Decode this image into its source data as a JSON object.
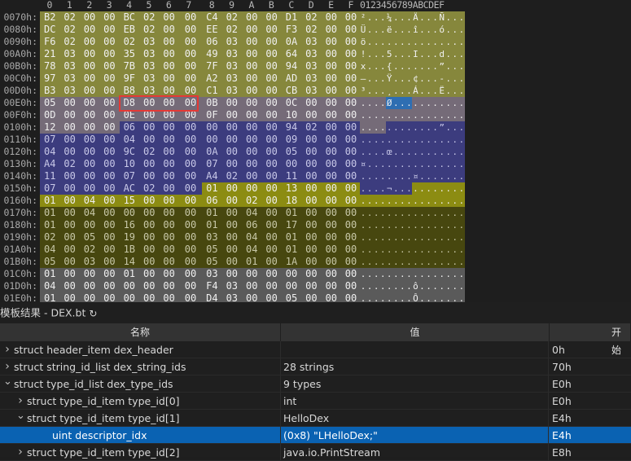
{
  "hex_editor": {
    "columns": [
      "0",
      "1",
      "2",
      "3",
      "4",
      "5",
      "6",
      "7",
      "8",
      "9",
      "A",
      "B",
      "C",
      "D",
      "E",
      "F"
    ],
    "ascii_header": "0123456789ABCDEF",
    "rows": [
      {
        "offset": "0070h:",
        "bytes": [
          "B2",
          "02",
          "00",
          "00",
          "BC",
          "02",
          "00",
          "00",
          "C4",
          "02",
          "00",
          "00",
          "D1",
          "02",
          "00",
          "00"
        ],
        "ascii": "²...¼...Ä...Ñ...",
        "region": "olive-a"
      },
      {
        "offset": "0080h:",
        "bytes": [
          "DC",
          "02",
          "00",
          "00",
          "EB",
          "02",
          "00",
          "00",
          "EE",
          "02",
          "00",
          "00",
          "F3",
          "02",
          "00",
          "00"
        ],
        "ascii": "Ü...ë...î...ó...",
        "region": "olive-a"
      },
      {
        "offset": "0090h:",
        "bytes": [
          "F6",
          "02",
          "00",
          "00",
          "02",
          "03",
          "00",
          "00",
          "06",
          "03",
          "00",
          "00",
          "0A",
          "03",
          "00",
          "00"
        ],
        "ascii": "ö...............",
        "region": "olive-a"
      },
      {
        "offset": "00A0h:",
        "bytes": [
          "21",
          "03",
          "00",
          "00",
          "35",
          "03",
          "00",
          "00",
          "49",
          "03",
          "00",
          "00",
          "64",
          "03",
          "00",
          "00"
        ],
        "ascii": "!...5...I...d...",
        "region": "olive-a"
      },
      {
        "offset": "00B0h:",
        "bytes": [
          "78",
          "03",
          "00",
          "00",
          "7B",
          "03",
          "00",
          "00",
          "7F",
          "03",
          "00",
          "00",
          "94",
          "03",
          "00",
          "00"
        ],
        "ascii": "x...{.......”...",
        "region": "olive-a"
      },
      {
        "offset": "00C0h:",
        "bytes": [
          "97",
          "03",
          "00",
          "00",
          "9F",
          "03",
          "00",
          "00",
          "A2",
          "03",
          "00",
          "00",
          "AD",
          "03",
          "00",
          "00"
        ],
        "ascii": "–...Ÿ...¢...-...",
        "region": "olive-a"
      },
      {
        "offset": "00D0h:",
        "bytes": [
          "B3",
          "03",
          "00",
          "00",
          "B8",
          "03",
          "00",
          "00",
          "C1",
          "03",
          "00",
          "00",
          "CB",
          "03",
          "00",
          "00"
        ],
        "ascii": "³...¸...Á...Ë...",
        "region": "olive-a"
      },
      {
        "offset": "00E0h:",
        "bytes": [
          "05",
          "00",
          "00",
          "00",
          "D8",
          "00",
          "00",
          "00",
          "0B",
          "00",
          "00",
          "00",
          "0C",
          "00",
          "00",
          "00"
        ],
        "ascii": "....Ø...........",
        "region": "mauve"
      },
      {
        "offset": "00F0h:",
        "bytes": [
          "0D",
          "00",
          "00",
          "00",
          "0E",
          "00",
          "00",
          "00",
          "0F",
          "00",
          "00",
          "00",
          "10",
          "00",
          "00",
          "00"
        ],
        "ascii": "................",
        "region": "mauve"
      },
      {
        "offset": "0100h:",
        "bytes": [
          "12",
          "00",
          "00",
          "00",
          "06",
          "00",
          "00",
          "00",
          "00",
          "00",
          "00",
          "00",
          "94",
          "02",
          "00",
          "00"
        ],
        "ascii": "............”...",
        "region": "mix-100"
      },
      {
        "offset": "0110h:",
        "bytes": [
          "07",
          "00",
          "00",
          "00",
          "04",
          "00",
          "00",
          "00",
          "00",
          "00",
          "00",
          "00",
          "09",
          "00",
          "00",
          "00"
        ],
        "ascii": "................",
        "region": "blue"
      },
      {
        "offset": "0120h:",
        "bytes": [
          "04",
          "00",
          "00",
          "00",
          "9C",
          "02",
          "00",
          "00",
          "0A",
          "00",
          "00",
          "00",
          "05",
          "00",
          "00",
          "00"
        ],
        "ascii": "....œ...........",
        "region": "blue"
      },
      {
        "offset": "0130h:",
        "bytes": [
          "A4",
          "02",
          "00",
          "00",
          "10",
          "00",
          "00",
          "00",
          "07",
          "00",
          "00",
          "00",
          "00",
          "00",
          "00",
          "00"
        ],
        "ascii": "¤...............",
        "region": "blue"
      },
      {
        "offset": "0140h:",
        "bytes": [
          "11",
          "00",
          "00",
          "00",
          "07",
          "00",
          "00",
          "00",
          "A4",
          "02",
          "00",
          "00",
          "11",
          "00",
          "00",
          "00"
        ],
        "ascii": "........¤.......",
        "region": "blue"
      },
      {
        "offset": "0150h:",
        "bytes": [
          "07",
          "00",
          "00",
          "00",
          "AC",
          "02",
          "00",
          "00",
          "01",
          "00",
          "00",
          "00",
          "13",
          "00",
          "00",
          "00"
        ],
        "ascii": "....¬...........",
        "region": "mix-150"
      },
      {
        "offset": "0160h:",
        "bytes": [
          "01",
          "00",
          "04",
          "00",
          "15",
          "00",
          "00",
          "00",
          "06",
          "00",
          "02",
          "00",
          "18",
          "00",
          "00",
          "00"
        ],
        "ascii": "................",
        "region": "olive-b"
      },
      {
        "offset": "0170h:",
        "bytes": [
          "01",
          "00",
          "04",
          "00",
          "00",
          "00",
          "00",
          "00",
          "01",
          "00",
          "04",
          "00",
          "01",
          "00",
          "00",
          "00"
        ],
        "ascii": "................",
        "region": "olive-c"
      },
      {
        "offset": "0180h:",
        "bytes": [
          "01",
          "00",
          "00",
          "00",
          "16",
          "00",
          "00",
          "00",
          "01",
          "00",
          "06",
          "00",
          "17",
          "00",
          "00",
          "00"
        ],
        "ascii": "................",
        "region": "olive-c"
      },
      {
        "offset": "0190h:",
        "bytes": [
          "02",
          "00",
          "05",
          "00",
          "19",
          "00",
          "00",
          "00",
          "03",
          "00",
          "04",
          "00",
          "01",
          "00",
          "00",
          "00"
        ],
        "ascii": "................",
        "region": "olive-c"
      },
      {
        "offset": "01A0h:",
        "bytes": [
          "04",
          "00",
          "02",
          "00",
          "1B",
          "00",
          "00",
          "00",
          "05",
          "00",
          "04",
          "00",
          "01",
          "00",
          "00",
          "00"
        ],
        "ascii": "................",
        "region": "olive-c"
      },
      {
        "offset": "01B0h:",
        "bytes": [
          "05",
          "00",
          "03",
          "00",
          "14",
          "00",
          "00",
          "00",
          "05",
          "00",
          "01",
          "00",
          "1A",
          "00",
          "00",
          "00"
        ],
        "ascii": "................",
        "region": "olive-c"
      },
      {
        "offset": "01C0h:",
        "bytes": [
          "01",
          "00",
          "00",
          "00",
          "01",
          "00",
          "00",
          "00",
          "03",
          "00",
          "00",
          "00",
          "00",
          "00",
          "00",
          "00"
        ],
        "ascii": "................",
        "region": "gray"
      },
      {
        "offset": "01D0h:",
        "bytes": [
          "04",
          "00",
          "00",
          "00",
          "00",
          "00",
          "00",
          "00",
          "F4",
          "03",
          "00",
          "00",
          "00",
          "00",
          "00",
          "00"
        ],
        "ascii": "........ô.......",
        "region": "gray"
      },
      {
        "offset": "01E0h:",
        "bytes": [
          "01",
          "00",
          "00",
          "00",
          "00",
          "00",
          "00",
          "00",
          "D4",
          "03",
          "00",
          "00",
          "05",
          "00",
          "00",
          "00"
        ],
        "ascii": "........Ô.......",
        "region": "gray"
      }
    ],
    "colors": {
      "olive_a": "#86873c",
      "olive_b": "#8c8c12",
      "olive_c": "#47470f",
      "mauve": "#756b78",
      "blue": "#3c3c7e",
      "gray": "#5a5a5a",
      "ascii_highlight": "#2e6eb2",
      "selection_box": "#e53935"
    }
  },
  "template_panel": {
    "title": "模板结果 - DEX.bt",
    "refresh_icon": "↻",
    "columns": {
      "name": "名称",
      "value": "值",
      "start": "开始"
    },
    "rows": [
      {
        "indent": 0,
        "toggle": "collapsed",
        "name": "struct header_item dex_header",
        "value": "",
        "start": "0h"
      },
      {
        "indent": 0,
        "toggle": "collapsed",
        "name": "struct string_id_list dex_string_ids",
        "value": "28 strings",
        "start": "70h"
      },
      {
        "indent": 0,
        "toggle": "expanded",
        "name": "struct type_id_list dex_type_ids",
        "value": "9 types",
        "start": "E0h"
      },
      {
        "indent": 1,
        "toggle": "collapsed",
        "name": "struct type_id_item type_id[0]",
        "value": "int",
        "start": "E0h"
      },
      {
        "indent": 1,
        "toggle": "expanded",
        "name": "struct type_id_item type_id[1]",
        "value": "HelloDex",
        "start": "E4h"
      },
      {
        "indent": 2,
        "toggle": "none",
        "name": "uint descriptor_idx",
        "value": "(0x8) \"LHelloDex;\"",
        "start": "E4h",
        "selected": true
      },
      {
        "indent": 1,
        "toggle": "collapsed",
        "name": "struct type_id_item type_id[2]",
        "value": "java.io.PrintStream",
        "start": "E8h"
      }
    ]
  }
}
